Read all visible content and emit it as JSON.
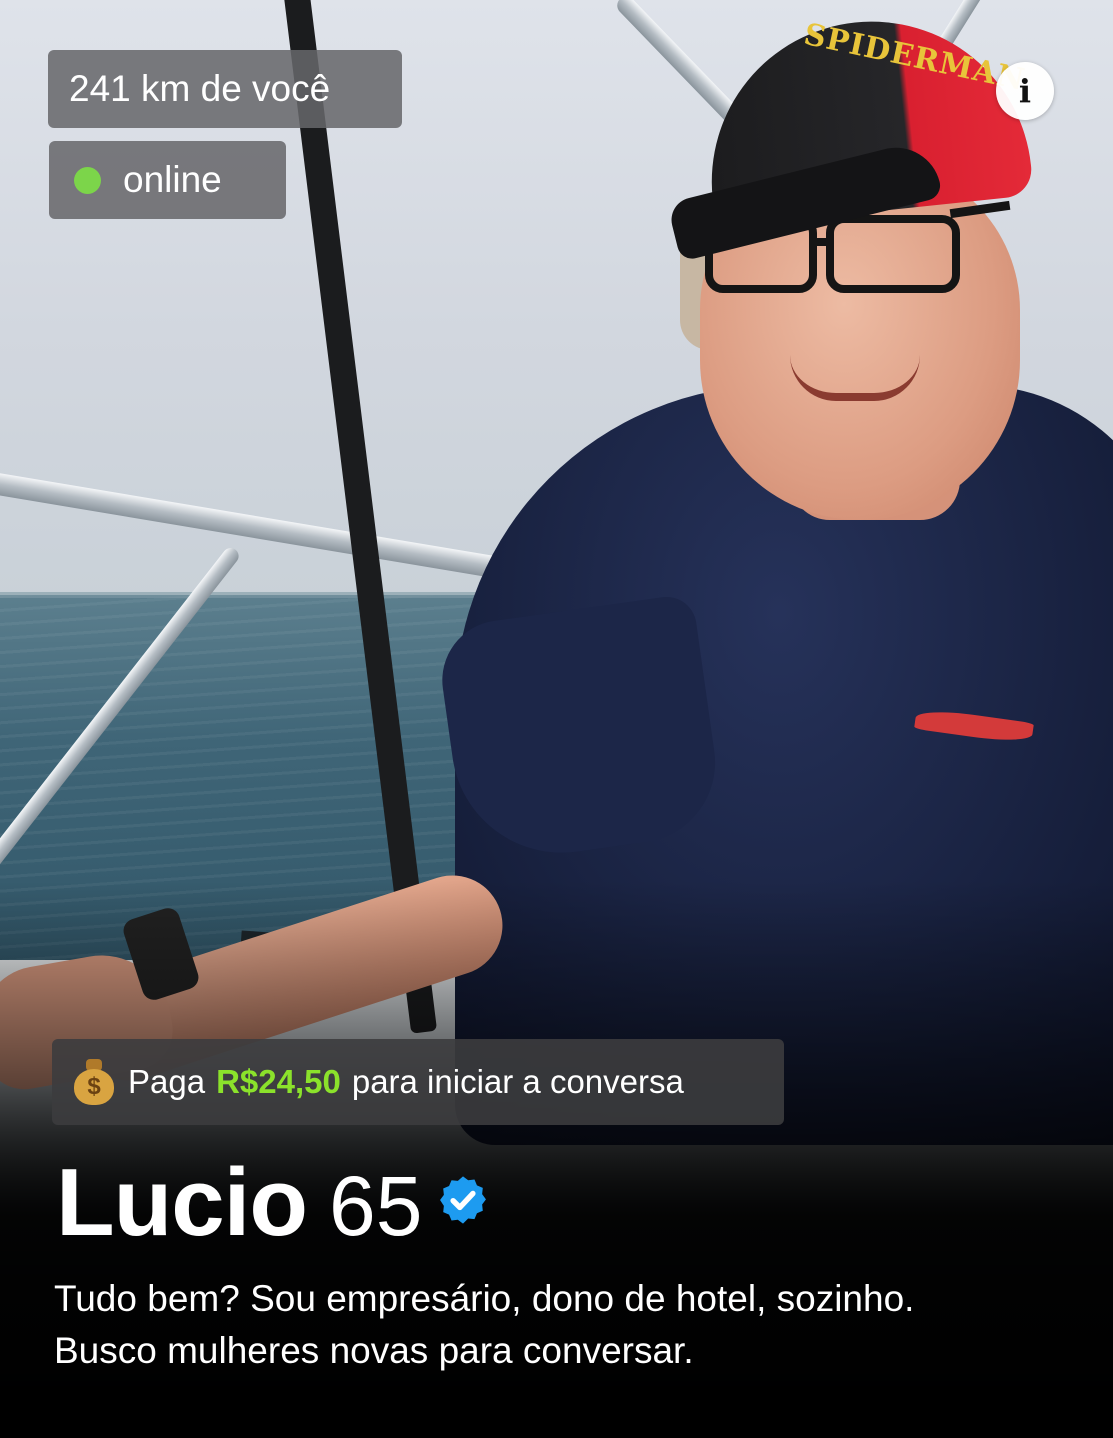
{
  "profile": {
    "distance": "241 km de você",
    "status": "online",
    "status_color": "#7cd54a",
    "name": "Lucio",
    "age": "65",
    "verified_icon": "verified-badge-icon",
    "bio_line1": "Tudo bem? Sou empresário, dono de hotel, sozinho.",
    "bio_line2": "Busco mulheres novas para conversar."
  },
  "payment_banner": {
    "icon": "money-bag-icon",
    "prefix": "Paga",
    "amount": "R$24,50",
    "suffix": "para iniciar a conversa",
    "amount_color": "#8be22b"
  },
  "photo": {
    "cap_text": "SPIDERMAN"
  },
  "info_button": {
    "icon": "info-icon",
    "glyph": "i"
  },
  "colors": {
    "chip_bg": "#66666a",
    "verified_blue": "#1d9bf0"
  }
}
